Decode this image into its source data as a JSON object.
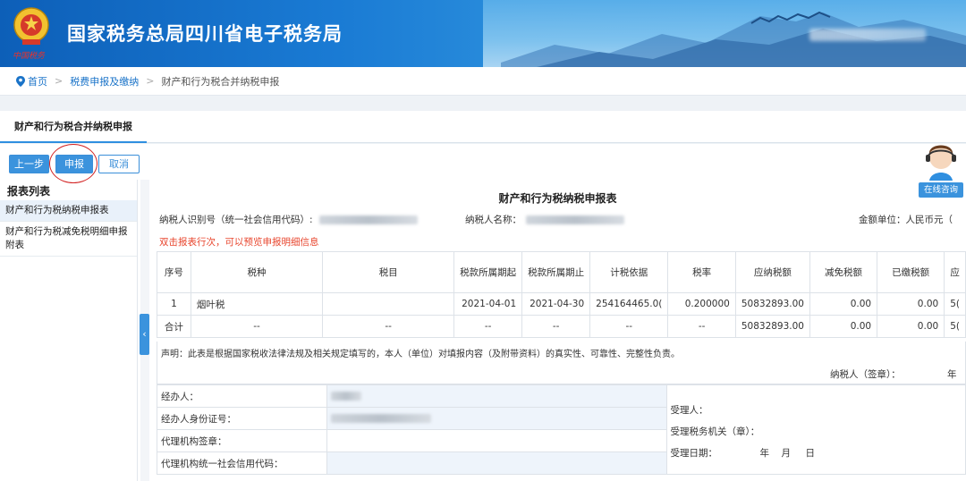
{
  "header": {
    "title": "国家税务总局四川省电子税务局",
    "emblem_caption": "中国税务",
    "accent_color": "#1a7bd4"
  },
  "breadcrumb": {
    "home": "首页",
    "level1": "税费申报及缴纳",
    "current": "财产和行为税合并纳税申报"
  },
  "tab": {
    "label": "财产和行为税合并纳税申报"
  },
  "toolbar": {
    "prev_label": "上一步",
    "submit_label": "申报",
    "cancel_label": "取消"
  },
  "sidebar": {
    "title": "报表列表",
    "items": [
      {
        "label": "财产和行为税纳税申报表"
      },
      {
        "label": "财产和行为税减免税明细申报附表"
      }
    ]
  },
  "form": {
    "title": "财产和行为税纳税申报表",
    "taxpayer_id_label": "纳税人识别号（统一社会信用代码）:",
    "taxpayer_name_label": "纳税人名称：",
    "currency_label": "金额单位：人民币元（",
    "hint": "双击报表行次，可以预览申报明细信息",
    "columns": [
      "序号",
      "税种",
      "税目",
      "税款所属期起",
      "税款所属期止",
      "计税依据",
      "税率",
      "应纳税额",
      "减免税额",
      "已缴税额",
      "应"
    ],
    "rows": [
      [
        "1",
        "烟叶税",
        "",
        "2021-04-01",
        "2021-04-30",
        "254164465.0(",
        "0.200000",
        "50832893.00",
        "0.00",
        "0.00",
        "5("
      ],
      [
        "合计",
        "--",
        "--",
        "--",
        "--",
        "--",
        "--",
        "50832893.00",
        "0.00",
        "0.00",
        "5("
      ]
    ],
    "declaration": "声明：此表是根据国家税收法律法规及相关规定填写的，本人（单位）对填报内容（及附带资料）的真实性、可靠性、完整性负责。",
    "signer_label": "纳税人（签章）：",
    "signer_year": "年",
    "handler_label": "经办人：",
    "handler_id_label": "经办人身份证号：",
    "agency_seal_label": "代理机构签章：",
    "agency_code_label": "代理机构统一社会信用代码：",
    "acceptor_label": "受理人：",
    "accept_office_label": "受理税务机关（章）：",
    "accept_date_label": "受理日期：",
    "date_year": "年",
    "date_month": "月",
    "date_day": "日"
  },
  "consult": {
    "label": "在线咨询"
  }
}
